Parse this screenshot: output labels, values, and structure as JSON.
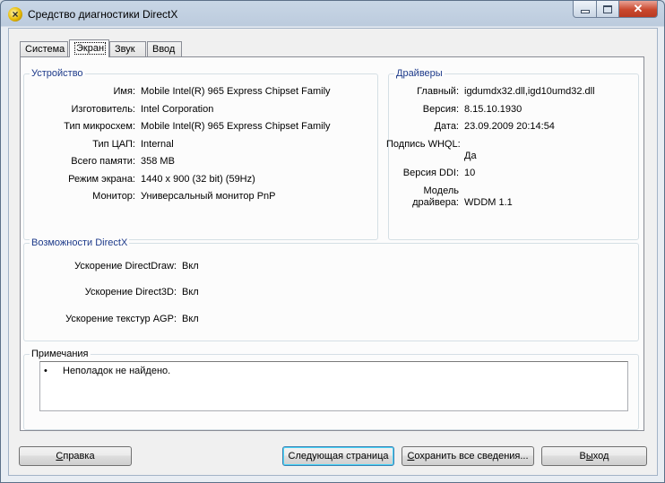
{
  "window": {
    "title": "Средство диагностики DirectX",
    "close_glyph": "✕"
  },
  "tabs": [
    {
      "label": "Система"
    },
    {
      "label": "Экран"
    },
    {
      "label": "Звук"
    },
    {
      "label": "Ввод"
    }
  ],
  "device": {
    "title": "Устройство",
    "rows": [
      {
        "label": "Имя:",
        "value": "Mobile Intel(R) 965 Express Chipset Family"
      },
      {
        "label": "Изготовитель:",
        "value": "Intel Corporation"
      },
      {
        "label": "Тип микросхем:",
        "value": "Mobile Intel(R) 965 Express Chipset Family"
      },
      {
        "label": "Тип ЦАП:",
        "value": "Internal"
      },
      {
        "label": "Всего памяти:",
        "value": "358 MB"
      },
      {
        "label": "Режим экрана:",
        "value": "1440 x 900 (32 bit) (59Hz)"
      },
      {
        "label": "Монитор:",
        "value": "Универсальный монитор PnP"
      }
    ]
  },
  "drivers": {
    "title": "Драйверы",
    "main_label": "Главный:",
    "main_value": "igdumdx32.dll,igd10umd32.dll",
    "version_label": "Версия:",
    "version_value": "8.15.10.1930",
    "date_label": "Дата:",
    "date_value": "23.09.2009 20:14:54",
    "whql_label": "Подпись WHQL:",
    "whql_value": "Да",
    "ddi_label": "Версия DDI:",
    "ddi_value": "10",
    "model_label_1": "Модель",
    "model_label_2": "драйвера:",
    "model_value": "WDDM 1.1"
  },
  "directx": {
    "title": "Возможности DirectX",
    "rows": [
      {
        "label": "Ускорение DirectDraw:",
        "value": "Вкл"
      },
      {
        "label": "Ускорение Direct3D:",
        "value": "Вкл"
      },
      {
        "label": "Ускорение текстур AGP:",
        "value": "Вкл"
      }
    ]
  },
  "notes": {
    "title": "Примечания",
    "bullet": "•",
    "text": "Неполадок не найдено."
  },
  "buttons": {
    "help_u": "С",
    "help_rest": "правка",
    "next": "Следующая страница",
    "save_pre": "",
    "save_u": "С",
    "save_rest": "охранить все сведения...",
    "exit_pre": "В",
    "exit_u": "ы",
    "exit_rest": "ход"
  }
}
